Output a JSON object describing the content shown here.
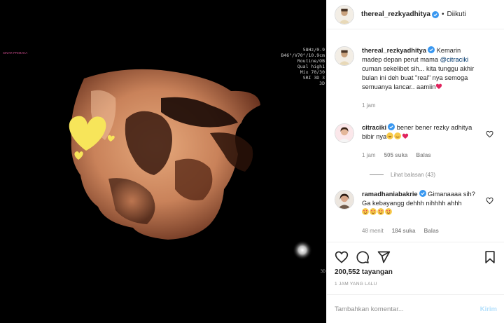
{
  "media": {
    "scan_logo": "SINAR PRIMAKA",
    "scan_info": [
      "58Hz/0.9",
      "B46°/V70°/10.9cm",
      "Routine/OB",
      "Qual high1",
      "Mix 70/30",
      "SRI 3D 3",
      "3D"
    ],
    "scan_corner": "3D"
  },
  "post": {
    "username": "thereal_rezkyadhitya",
    "separator": "•",
    "follow_label": "Diikuti",
    "caption_user": "thereal_rezkyadhitya",
    "caption_text_1": " Kemarin madep depan perut mama ",
    "caption_mention": "@citraciki",
    "caption_text_2": " cuman sekelibet sih... kita tunggu akhir bulan ini deh buat \"real\" nya semoga semuanya lancar.. aamiin",
    "caption_time": "1 jam"
  },
  "comments": [
    {
      "user": "citraciki",
      "text": " bener bener rezky adhitya bibir nya",
      "time": "1 jam",
      "likes": "505 suka",
      "reply": "Balas",
      "view_replies": "Lihat balasan (43)"
    },
    {
      "user": "ramadhaniabakrie",
      "text": " Gimanaaaa sih? Ga kebayangg dehhh nihhhh ahhh",
      "time": "48 menit",
      "likes": "184 suka",
      "reply": "Balas"
    }
  ],
  "stats": {
    "views": "200,552 tayangan",
    "posted": "1 JAM YANG LALU"
  },
  "composer": {
    "placeholder": "Tambahkan komentar...",
    "send_label": "Kirim"
  },
  "colors": {
    "verified": "#3897f0",
    "heart": "#ed4956",
    "link": "#00376b",
    "muted": "#8e8e8e",
    "send_disabled": "#b2dffc"
  },
  "icons": [
    "heart-icon",
    "comment-icon",
    "share-icon",
    "bookmark-icon",
    "verified-icon"
  ]
}
